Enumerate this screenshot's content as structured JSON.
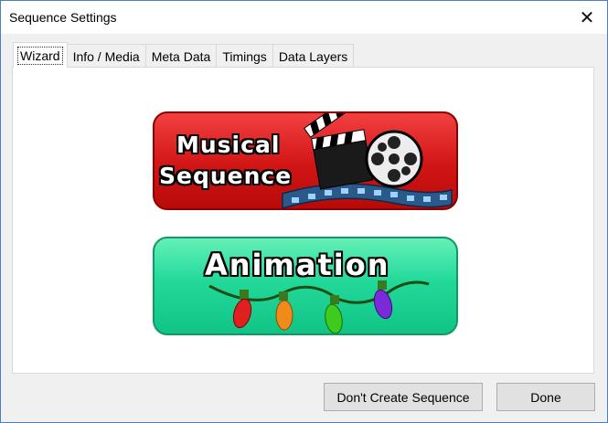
{
  "window": {
    "title": "Sequence Settings",
    "close_glyph": "✕"
  },
  "tabs": [
    {
      "label": "Wizard",
      "active": true
    },
    {
      "label": "Info / Media",
      "active": false
    },
    {
      "label": "Meta Data",
      "active": false
    },
    {
      "label": "Timings",
      "active": false
    },
    {
      "label": "Data Layers",
      "active": false
    }
  ],
  "wizard": {
    "musical_line1": "Musical",
    "musical_line2": "Sequence",
    "animation_label": "Animation",
    "icons": [
      "clapperboard-icon",
      "film-reel-icon",
      "film-strip-icon",
      "christmas-lights-icon"
    ]
  },
  "buttons": {
    "dont_create": "Don't Create Sequence",
    "done": "Done"
  },
  "colors": {
    "musical_banner": "#d21515",
    "animation_banner": "#22d99a",
    "window_border": "#4a7ec9"
  }
}
